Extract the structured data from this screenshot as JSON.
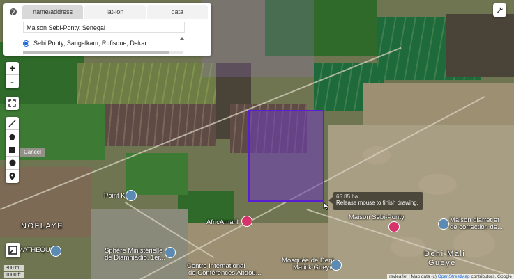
{
  "geocoder": {
    "tabs": [
      "name/address",
      "lat-lon",
      "data"
    ],
    "active_tab": 0,
    "query": "Maison Sebi-Ponty, Senegal",
    "result": "Sebi Ponty, Sangalkam, Rufisque, Dakar"
  },
  "zoom": {
    "in_label": "+",
    "out_label": "-"
  },
  "draw": {
    "cancel_label": "Cancel"
  },
  "tooltip": {
    "area": "65.85 ha",
    "instruction": "Release mouse to finish drawing."
  },
  "places": [
    "NOFLAYE",
    "Point K",
    "AfricAmaril",
    "Maison Sebi-Ponty",
    "Maison diarret et",
    "de correction de...",
    "Deni Mali",
    "Gueye",
    "Mosquée de Deni",
    "Malick Gueye",
    "Sphère Ministérielle",
    "de Diamniadio, 1er...",
    "Centre International",
    "de Conférences Abdou...",
    "MATHEQUE"
  ],
  "scale": {
    "metric": "300 m",
    "imperial": "1000 ft"
  },
  "attribution": {
    "prefix": "rsvleaflet | Map data (c) ",
    "link": "OpenStreetMap",
    "suffix": " contributors, Google"
  },
  "colors": {
    "drawn_fill": "#6e3cbe",
    "drawn_border": "#5a1fd0",
    "active_radio": "#1a66d6"
  }
}
